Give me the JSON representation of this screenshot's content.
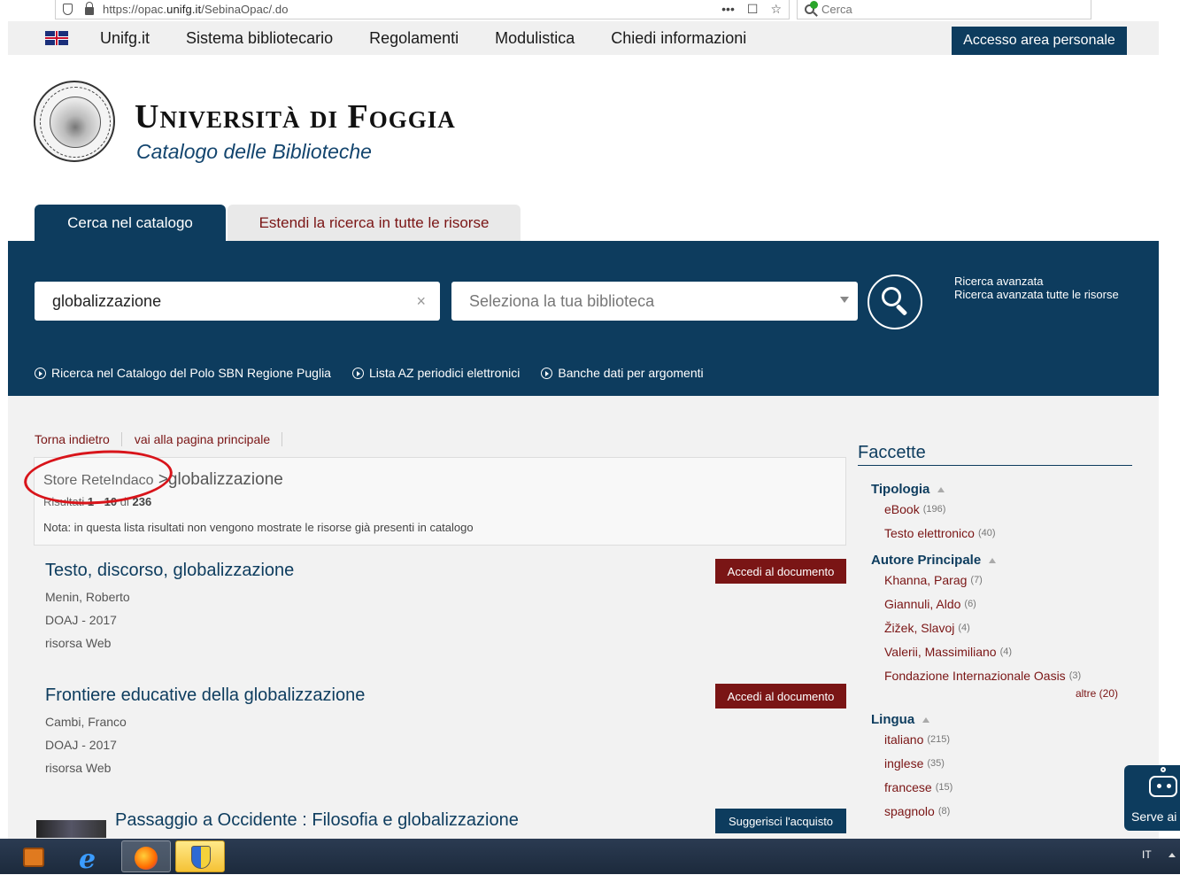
{
  "browser": {
    "url_prefix": "https://opac.",
    "url_domain": "unifg.it",
    "url_path": "/SebinaOpac/.do",
    "menu_dots": "•••",
    "search_placeholder": "Cerca"
  },
  "topnav": {
    "items": [
      "Unifg.it",
      "Sistema bibliotecario",
      "Regolamenti",
      "Modulistica",
      "Chiedi informazioni"
    ],
    "access_button": "Accesso area personale"
  },
  "header": {
    "title": "Università di Foggia",
    "subtitle": "Catalogo delle Biblioteche"
  },
  "tabs": {
    "active": "Cerca nel catalogo",
    "inactive": "Estendi la ricerca in tutte le risorse"
  },
  "search": {
    "query": "globalizzazione",
    "clear": "×",
    "library_placeholder": "Seleziona la tua biblioteca",
    "advanced": "Ricerca avanzata",
    "advanced_all": "Ricerca avanzata tutte le risorse"
  },
  "band_links": [
    "Ricerca nel Catalogo del Polo SBN Regione Puglia",
    "Lista AZ periodici elettronici",
    "Banche dati per argomenti"
  ],
  "breadcrumbs": {
    "back": "Torna indietro",
    "home": "vai alla pagina principale"
  },
  "results_box": {
    "store": "Store ReteIndaco",
    "separator": ">",
    "query": "globalizzazione",
    "count_prefix": "Risultati",
    "count_range": "1 - 10",
    "count_of": "di",
    "count_total": "236",
    "note": "Nota: in questa lista risultati non vengono mostrate le risorse già presenti in catalogo"
  },
  "results": [
    {
      "title": "Testo, discorso, globalizzazione",
      "author": "Menin, Roberto",
      "source": "DOAJ - 2017",
      "type": "risorsa Web",
      "button": "Accedi al documento"
    },
    {
      "title": "Frontiere educative della globalizzazione",
      "author": "Cambi, Franco",
      "source": "DOAJ - 2017",
      "type": "risorsa Web",
      "button": "Accedi al documento"
    },
    {
      "title": "Passaggio a Occidente : Filosofia e globalizzazione",
      "button": "Suggerisci l'acquisto"
    }
  ],
  "facets": {
    "heading": "Faccette",
    "tipologia": {
      "label": "Tipologia",
      "items": [
        {
          "name": "eBook",
          "count": "(196)"
        },
        {
          "name": "Testo elettronico",
          "count": "(40)"
        }
      ]
    },
    "autore": {
      "label": "Autore Principale",
      "items": [
        {
          "name": "Khanna, Parag",
          "count": "(7)"
        },
        {
          "name": "Giannuli, Aldo",
          "count": "(6)"
        },
        {
          "name": "Žižek, Slavoj",
          "count": "(4)"
        },
        {
          "name": "Valerii, Massimiliano",
          "count": "(4)"
        },
        {
          "name": "Fondazione Internazionale Oasis",
          "count": "(3)"
        }
      ],
      "more": "altre (20)"
    },
    "lingua": {
      "label": "Lingua",
      "items": [
        {
          "name": "italiano",
          "count": "(215)"
        },
        {
          "name": "inglese",
          "count": "(35)"
        },
        {
          "name": "francese",
          "count": "(15)"
        },
        {
          "name": "spagnolo",
          "count": "(8)"
        }
      ]
    }
  },
  "chatbot": {
    "label": "Serve ai"
  },
  "taskbar": {
    "lang": "IT"
  },
  "colors": {
    "brand_blue": "#0d3c5e",
    "brand_red": "#7a1515",
    "annotation_red": "#d8141a"
  }
}
